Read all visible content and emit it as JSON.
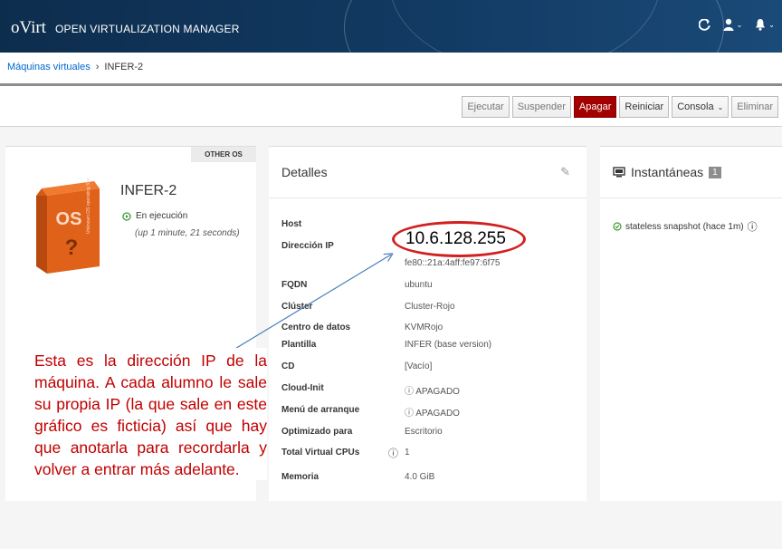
{
  "header": {
    "logo": "oVirt",
    "title": "OPEN VIRTUALIZATION MANAGER",
    "icons": [
      "refresh-icon",
      "user-icon",
      "bell-icon"
    ]
  },
  "breadcrumb": {
    "parent": "Máquinas virtuales",
    "separator": "›",
    "current": "INFER-2"
  },
  "toolbar": {
    "run": "Ejecutar",
    "suspend": "Suspender",
    "shutdown": "Apagar",
    "reboot": "Reiniciar",
    "console": "Consola",
    "remove": "Eliminar"
  },
  "vm": {
    "os_tag": "OTHER OS",
    "name": "INFER-2",
    "status": "En ejecución",
    "uptime": "(up 1 minute, 21 seconds)"
  },
  "details": {
    "title": "Detalles",
    "ip_highlight": "10.6.128.255",
    "rows": [
      {
        "key": "Host",
        "value": ""
      },
      {
        "key": "Dirección IP",
        "value": ""
      },
      {
        "key": "",
        "value": "fe80::21a:4aff:fe97:6f75"
      },
      {
        "key": "FQDN",
        "value": "ubuntu"
      },
      {
        "key": "Clúster",
        "value": "Cluster-Rojo"
      },
      {
        "key": "Centro de datos",
        "value": "KVMRojo"
      },
      {
        "key": "Plantilla",
        "value": "INFER (base version)"
      },
      {
        "key": "CD",
        "value": "[Vacío]"
      },
      {
        "key": "Cloud-Init",
        "value": "APAGADO"
      },
      {
        "key": "Menú de arranque",
        "value": "APAGADO"
      },
      {
        "key": "Optimizado para",
        "value": "Escritorio"
      },
      {
        "key": "Total Virtual CPUs",
        "value": "1"
      },
      {
        "key": "Memoria",
        "value": "4.0 GiB"
      }
    ]
  },
  "snapshots": {
    "title": "Instantáneas",
    "count": "1",
    "item": "stateless snapshot (hace 1m)"
  },
  "annotation": {
    "text": "Esta es la dirección IP de la máquina. A cada alumno le sale su propia IP (la que sale en este gráfico es ficticia) así que hay que anotarla para recordarla y volver a entrar más adelante.",
    "color": "#c00000"
  },
  "colors": {
    "header_bg": "#123a63",
    "danger": "#a30000",
    "link": "#0066cc",
    "highlight": "#d21f1f"
  }
}
